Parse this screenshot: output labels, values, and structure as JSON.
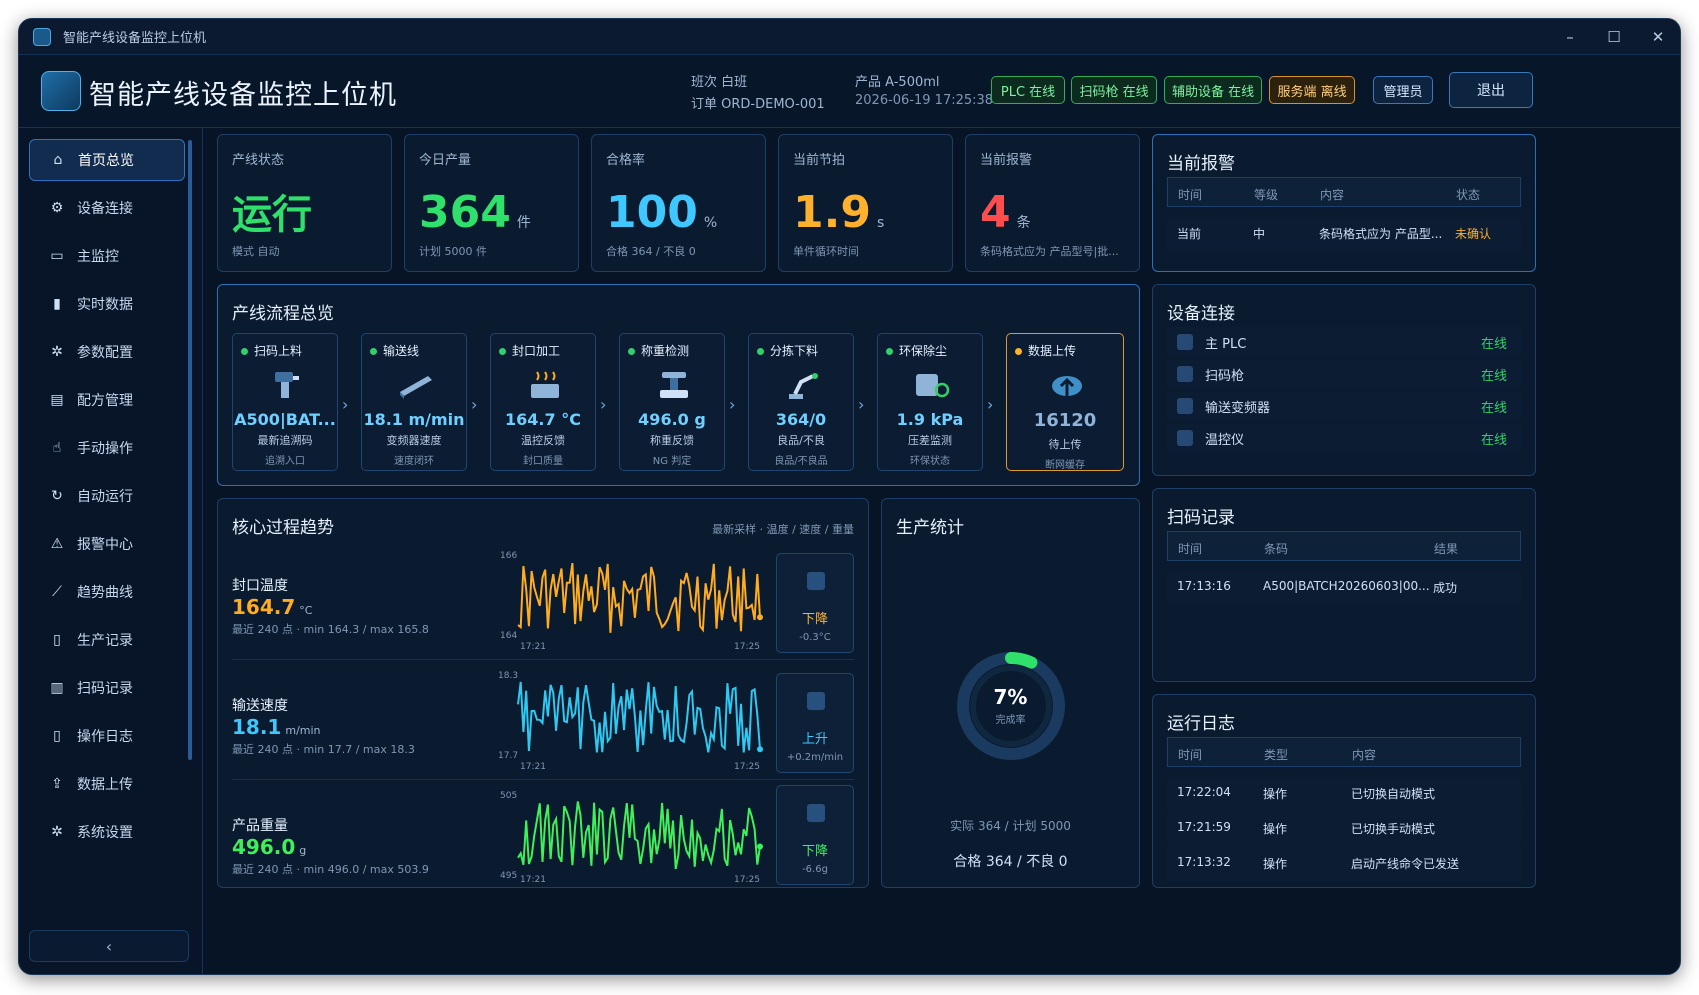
{
  "window": {
    "title": "智能产线设备监控上位机"
  },
  "header": {
    "title": "智能产线设备监控上位机",
    "shift": "班次 白班",
    "order": "订单 ORD-DEMO-001",
    "product": "产品 A-500ml",
    "datetime": "2026-06-19 17:25:38",
    "status_pills": [
      {
        "label": "PLC 在线",
        "state": "ok"
      },
      {
        "label": "扫码枪 在线",
        "state": "ok"
      },
      {
        "label": "辅助设备 在线",
        "state": "ok"
      },
      {
        "label": "服务端 离线",
        "state": "warn"
      }
    ],
    "user": "管理员",
    "logout": "退出"
  },
  "sidebar": {
    "items": [
      {
        "label": "首页总览",
        "icon": "home-icon",
        "active": true
      },
      {
        "label": "设备连接",
        "icon": "link-icon"
      },
      {
        "label": "主监控",
        "icon": "monitor-icon"
      },
      {
        "label": "实时数据",
        "icon": "bar-chart-icon"
      },
      {
        "label": "参数配置",
        "icon": "gear-icon"
      },
      {
        "label": "配方管理",
        "icon": "recipe-icon"
      },
      {
        "label": "手动操作",
        "icon": "hand-icon"
      },
      {
        "label": "自动运行",
        "icon": "refresh-icon"
      },
      {
        "label": "报警中心",
        "icon": "warning-icon"
      },
      {
        "label": "趋势曲线",
        "icon": "trend-icon"
      },
      {
        "label": "生产记录",
        "icon": "document-icon"
      },
      {
        "label": "扫码记录",
        "icon": "barcode-icon"
      },
      {
        "label": "操作日志",
        "icon": "log-icon"
      },
      {
        "label": "数据上传",
        "icon": "upload-icon"
      },
      {
        "label": "系统设置",
        "icon": "settings-icon"
      }
    ],
    "collapse": "‹"
  },
  "kpis": [
    {
      "label": "产线状态",
      "value": "运行",
      "unit": "",
      "sub": "模式 自动",
      "color": "#2fe06a"
    },
    {
      "label": "今日产量",
      "value": "364",
      "unit": "件",
      "sub": "计划 5000 件",
      "color": "#2fe06a"
    },
    {
      "label": "合格率",
      "value": "100",
      "unit": "%",
      "sub": "合格 364 / 不良 0",
      "color": "#3fc8ff"
    },
    {
      "label": "当前节拍",
      "value": "1.9",
      "unit": "s",
      "sub": "单件循环时间",
      "color": "#ffb12e"
    },
    {
      "label": "当前报警",
      "value": "4",
      "unit": "条",
      "sub": "条码格式应为 产品型号|批...",
      "color": "#ff4d4d"
    }
  ],
  "alarms": {
    "title": "当前报警",
    "headers": [
      "时间",
      "等级",
      "内容",
      "状态"
    ],
    "rows": [
      [
        "当前",
        "中",
        "条码格式应为 产品型...",
        "未确认"
      ]
    ]
  },
  "flow": {
    "title": "产线流程总览",
    "steps": [
      {
        "name": "扫码上料",
        "value": "A500|BAT...",
        "sub": "最新追溯码",
        "sub2": "追溯入口",
        "icon": "scanner-icon"
      },
      {
        "name": "输送线",
        "value": "18.1 m/min",
        "sub": "变频器速度",
        "sub2": "速度闭环",
        "icon": "conveyor-icon"
      },
      {
        "name": "封口加工",
        "value": "164.7 °C",
        "sub": "温控反馈",
        "sub2": "封口质量",
        "icon": "heater-icon"
      },
      {
        "name": "称重检测",
        "value": "496.0 g",
        "sub": "称重反馈",
        "sub2": "NG 判定",
        "icon": "scale-icon"
      },
      {
        "name": "分拣下料",
        "value": "364/0",
        "sub": "良品/不良",
        "sub2": "良品/不良品",
        "icon": "robot-arm-icon"
      },
      {
        "name": "环保除尘",
        "value": "1.9 kPa",
        "sub": "压差监测",
        "sub2": "环保状态",
        "icon": "dust-icon"
      },
      {
        "name": "数据上传",
        "value": "16120",
        "sub": "待上传",
        "sub2": "断网缓存",
        "icon": "cloud-upload-icon"
      }
    ]
  },
  "trends": {
    "title": "核心过程趋势",
    "note": "最新采样 · 温度 / 速度 / 重量",
    "items": [
      {
        "name": "封口温度",
        "value": "164.7",
        "unit": "°C",
        "stat": "最近 240 点 · min 164.3 / max 165.8",
        "ymax": "166",
        "ymin": "164",
        "t0": "17:21",
        "t1": "17:25",
        "dir": "下降",
        "delta": "-0.3°C",
        "color": "#ffad1f",
        "dircolor": "#ffb12e"
      },
      {
        "name": "输送速度",
        "value": "18.1",
        "unit": "m/min",
        "stat": "最近 240 点 · min 17.7 / max 18.3",
        "ymax": "18.3",
        "ymin": "17.7",
        "t0": "17:21",
        "t1": "17:25",
        "dir": "上升",
        "delta": "+0.2m/min",
        "color": "#2fc8f0",
        "dircolor": "#3fc8ff"
      },
      {
        "name": "产品重量",
        "value": "496.0",
        "unit": "g",
        "stat": "最近 240 点 · min 496.0 / max 503.9",
        "ymax": "505",
        "ymin": "495",
        "t0": "17:21",
        "t1": "17:25",
        "dir": "下降",
        "delta": "-6.6g",
        "color": "#3ff05a",
        "dircolor": "#3ff05a"
      }
    ]
  },
  "production": {
    "title": "生产统计",
    "percent": "7%",
    "ring_label": "完成率",
    "completion": 0.07,
    "actual_plan": "实际 364 / 计划 5000",
    "good_bad": "合格 364 / 不良 0"
  },
  "devices": {
    "title": "设备连接",
    "rows": [
      {
        "name": "主 PLC",
        "status": "在线"
      },
      {
        "name": "扫码枪",
        "status": "在线"
      },
      {
        "name": "输送变频器",
        "status": "在线"
      },
      {
        "name": "温控仪",
        "status": "在线"
      }
    ]
  },
  "scans": {
    "title": "扫码记录",
    "headers": [
      "时间",
      "条码",
      "结果"
    ],
    "rows": [
      [
        "17:13:16",
        "A500|BATCH20260603|00...",
        "成功"
      ]
    ]
  },
  "logs": {
    "title": "运行日志",
    "headers": [
      "时间",
      "类型",
      "内容"
    ],
    "rows": [
      [
        "17:22:04",
        "操作",
        "已切换自动模式"
      ],
      [
        "17:21:59",
        "操作",
        "已切换手动模式"
      ],
      [
        "17:13:32",
        "操作",
        "启动产线命令已发送"
      ]
    ]
  }
}
